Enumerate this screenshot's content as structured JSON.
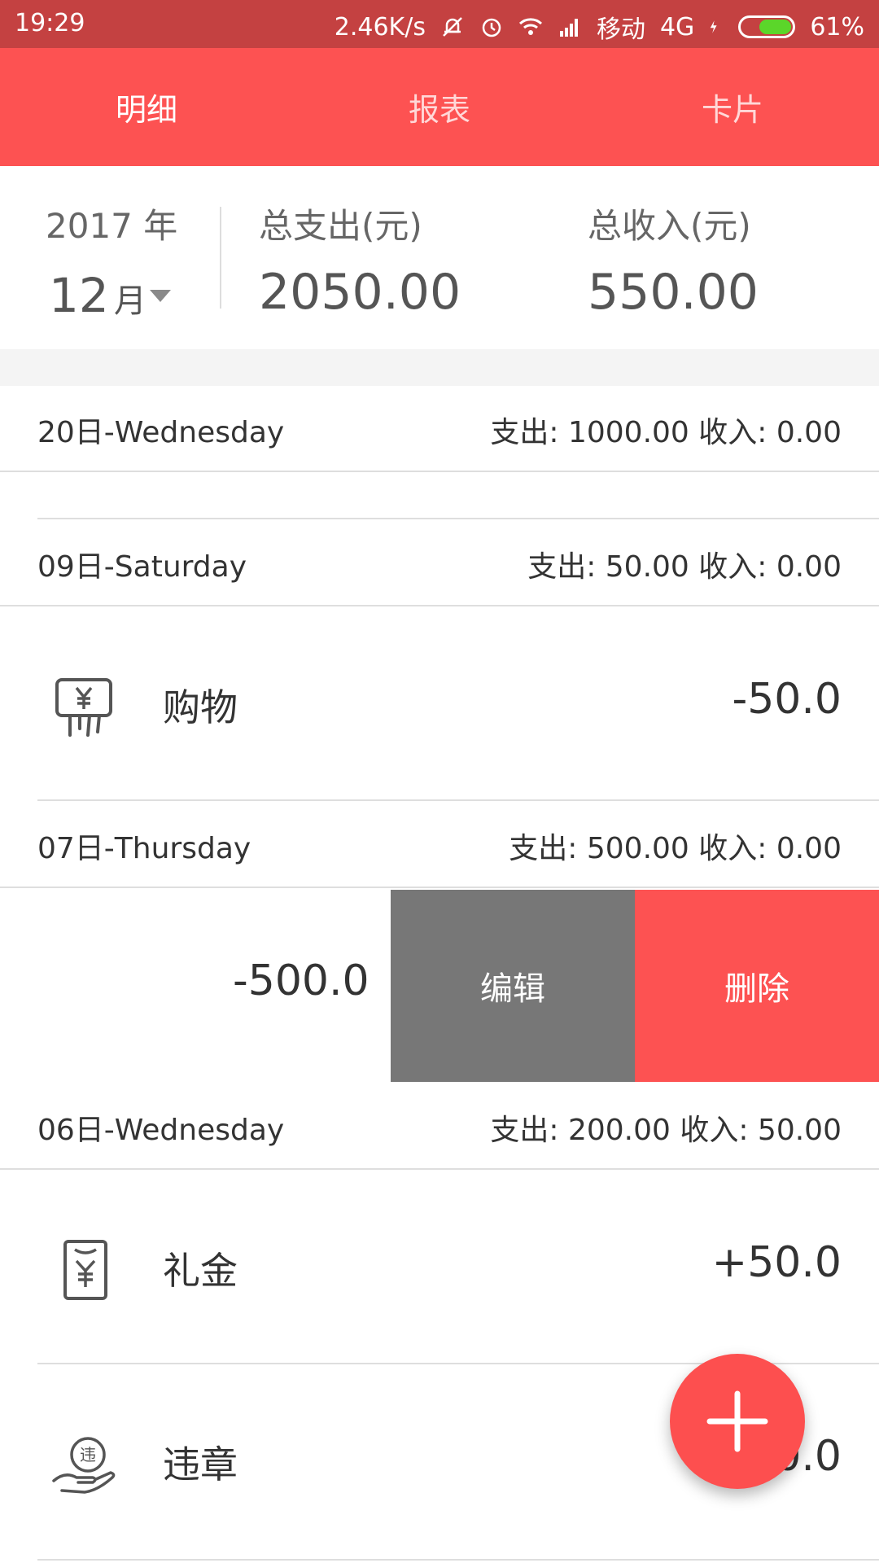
{
  "status_bar": {
    "time": "19:29",
    "speed": "2.46K/s",
    "carrier": "移动",
    "network": "4G",
    "battery": "61%",
    "battery_level": 0.61
  },
  "tabs": [
    {
      "label": "明细",
      "active": true
    },
    {
      "label": "报表",
      "active": false
    },
    {
      "label": "卡片",
      "active": false
    }
  ],
  "summary": {
    "year": "2017 年",
    "month": "12",
    "month_unit": "月",
    "expense_label": "总支出(元)",
    "expense_value": "2050.00",
    "income_label": "总收入(元)",
    "income_value": "550.00"
  },
  "days": [
    {
      "date": "20日-Wednesday",
      "summary": "支出: 1000.00 收入: 0.00"
    },
    {
      "date": "09日-Saturday",
      "summary": "支出: 50.00 收入: 0.00"
    },
    {
      "date": "07日-Thursday",
      "summary": "支出: 500.00 收入: 0.00"
    },
    {
      "date": "06日-Wednesday",
      "summary": "支出: 200.00 收入: 50.00"
    }
  ],
  "items": [
    {
      "name": "购物",
      "amount": "-50.0",
      "icon": "shopping-icon"
    },
    {
      "name": "",
      "amount": "-500.0",
      "icon": ""
    },
    {
      "name": "礼金",
      "amount": "+50.0",
      "icon": "gift-money-icon"
    },
    {
      "name": "违章",
      "amount": "-50.0",
      "icon": "violation-icon"
    }
  ],
  "swipe_actions": {
    "edit": "编辑",
    "delete": "删除"
  },
  "fab": {
    "icon": "plus-icon"
  },
  "colors": {
    "accent": "#fd5252",
    "status_bar": "#c44141",
    "edit_button": "#777777",
    "battery_fill": "#5bd62a"
  }
}
